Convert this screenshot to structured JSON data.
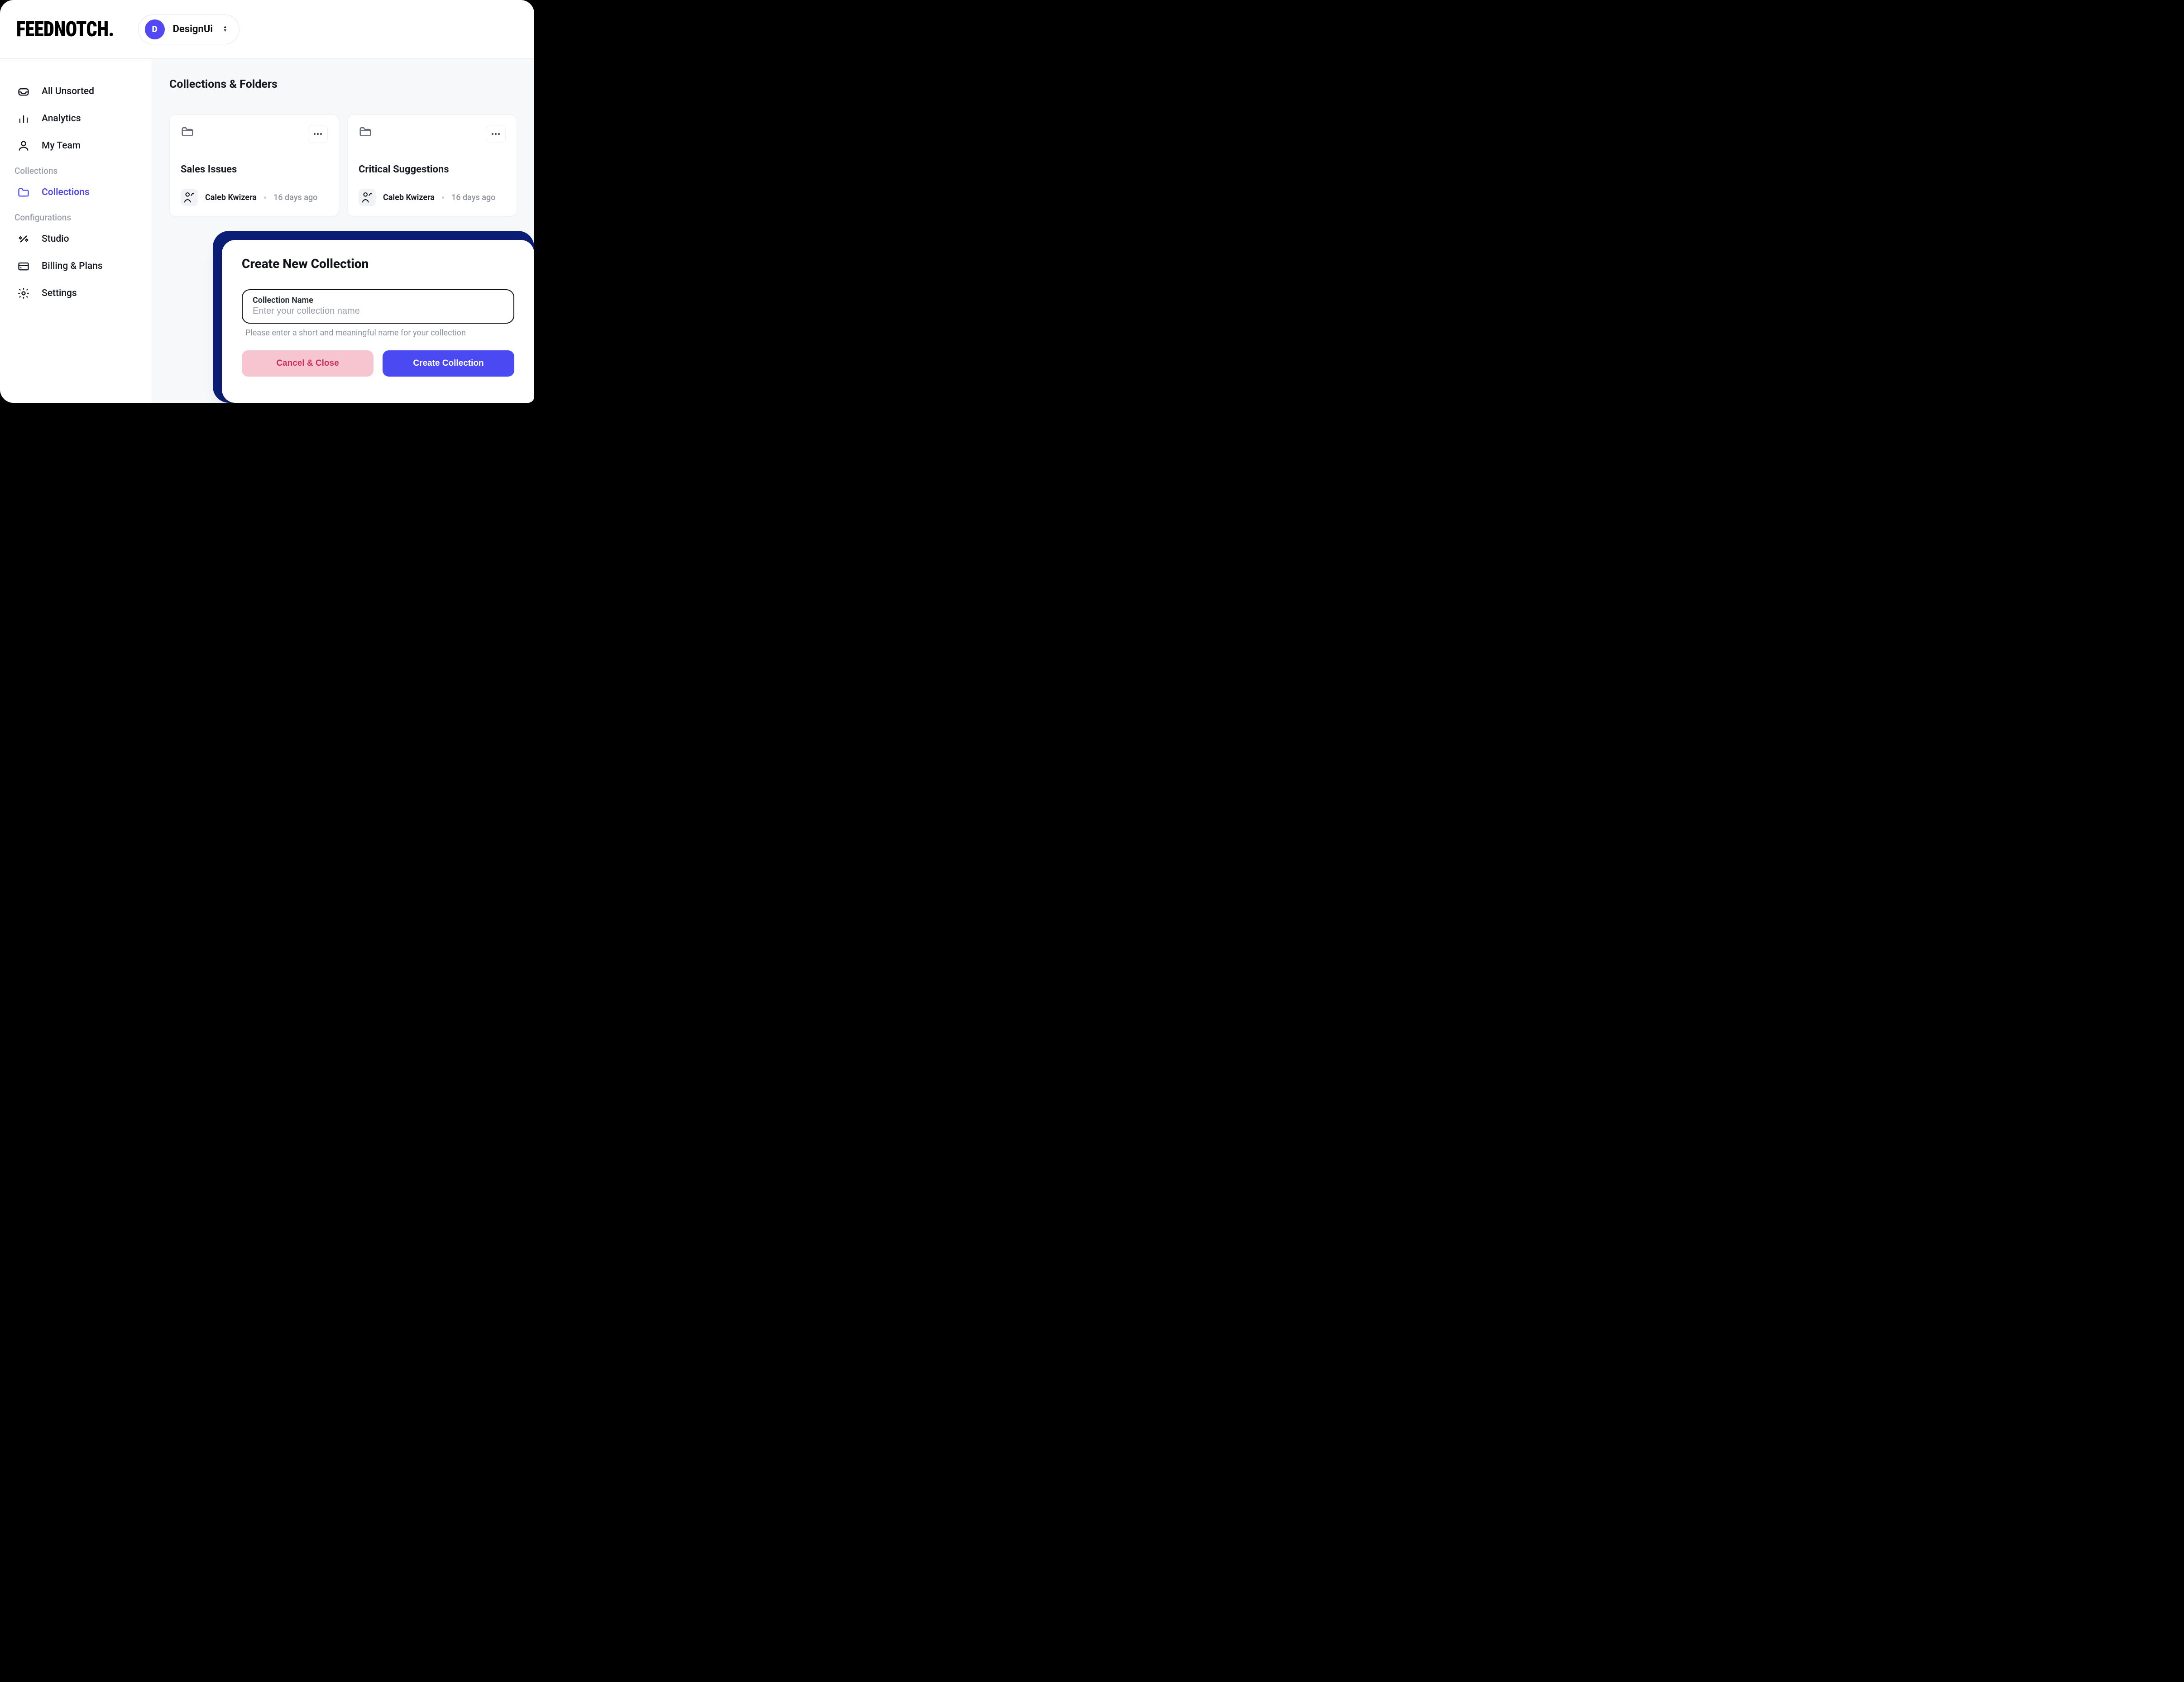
{
  "header": {
    "logo_text": "FEEDNOTCH.",
    "project_initial": "D",
    "project_name": "DesignUi"
  },
  "sidebar": {
    "items": [
      {
        "label": "All Unsorted"
      },
      {
        "label": "Analytics"
      },
      {
        "label": "My Team"
      }
    ],
    "section_collections_label": "Collections",
    "collections_item_label": "Collections",
    "section_configurations_label": "Configurations",
    "config_items": [
      {
        "label": "Studio"
      },
      {
        "label": "Billing & Plans"
      },
      {
        "label": "Settings"
      }
    ]
  },
  "main": {
    "page_title": "Collections & Folders",
    "cards": [
      {
        "title": "Sales Issues",
        "author": "Caleb Kwizera",
        "time": "16 days ago"
      },
      {
        "title": "Critical Suggestions",
        "author": "Caleb Kwizera",
        "time": "16 days ago"
      }
    ]
  },
  "modal": {
    "title": "Create New Collection",
    "field_label": "Collection Name",
    "field_placeholder": "Enter your collection name",
    "helper": "Please enter a short and meaningful name for your collection",
    "cancel_label": "Cancel & Close",
    "submit_label": "Create Collection"
  }
}
